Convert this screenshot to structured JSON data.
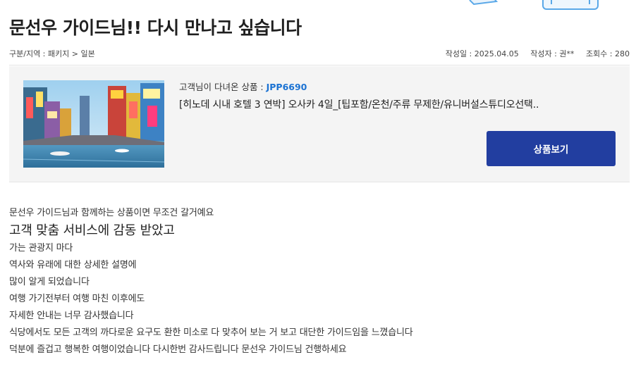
{
  "post": {
    "title": "문선우 가이드님!! 다시 만나고 싶습니다",
    "category": "구분/지역 : 패키지 > 일본",
    "date": "작성일 : 2025.04.05",
    "author": "작성자 : 권**",
    "views": "조회수 : 280"
  },
  "product": {
    "visited_prefix": "고객님이 다녀온 상품 : ",
    "code": "JPP6690",
    "name": "[히노데 시내 호텔 3 연박] 오사카 4일_[팁포함/온천/주류 무제한/유니버설스튜디오선택..",
    "button_label": "상품보기",
    "image_alt": "오사카 도톤보리 운하 야경"
  },
  "review_lines": [
    {
      "text": "문선우 가이드님과 함께하는 상품이면 무조건 갈거예요",
      "big": false
    },
    {
      "text": "고객 맞춤 서비스에 감동 받았고",
      "big": true
    },
    {
      "text": "가는 관광지 마다",
      "big": false
    },
    {
      "text": "역사와 유래에 대한 상세한 설명에",
      "big": false
    },
    {
      "text": "많이 알게 되었습니다",
      "big": false
    },
    {
      "text": "여행 가기전부터 여행 마친 이후에도",
      "big": false
    },
    {
      "text": "자세한 안내는 너무 감사했습니다",
      "big": false
    },
    {
      "text": "식당에서도 모든 고객의 까다로운 요구도 환한 미소로 다 맞추어 보는 거 보고 대단한 가이드임을 느꼈습니다",
      "big": false
    },
    {
      "text": "덕분에 즐겁고 행복한 여행이었습니다 다시한번 감사드립니다 문선우 가이드님 건행하세요",
      "big": false
    }
  ],
  "colors": {
    "accent_button": "#223ea0",
    "product_code": "#1c73d3",
    "box_background": "#f4f4f4"
  }
}
